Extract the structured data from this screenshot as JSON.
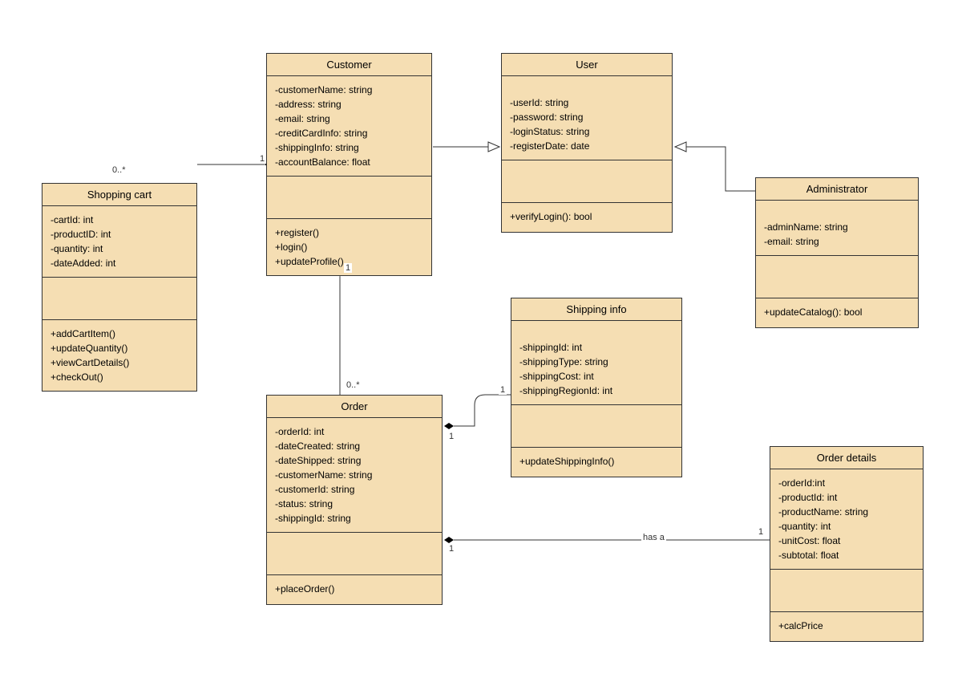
{
  "classes": {
    "shoppingCart": {
      "title": "Shopping cart",
      "attributes": [
        "-cartId: int",
        "-productID: int",
        "-quantity: int",
        "-dateAdded: int"
      ],
      "methods": [
        "+addCartItem()",
        "+updateQuantity()",
        "+viewCartDetails()",
        "+checkOut()"
      ]
    },
    "customer": {
      "title": "Customer",
      "attributes": [
        "-customerName: string",
        "-address: string",
        "-email: string",
        "-creditCardInfo: string",
        "-shippingInfo: string",
        "-accountBalance: float"
      ],
      "methods": [
        "+register()",
        "+login()",
        "+updateProfile()"
      ]
    },
    "user": {
      "title": "User",
      "attributes": [
        "-userId: string",
        "-password: string",
        "-loginStatus: string",
        "-registerDate: date"
      ],
      "methods": [
        "+verifyLogin(): bool"
      ]
    },
    "administrator": {
      "title": "Administrator",
      "attributes": [
        "-adminName: string",
        "-email: string"
      ],
      "methods": [
        "+updateCatalog(): bool"
      ]
    },
    "shippingInfo": {
      "title": "Shipping info",
      "attributes": [
        "-shippingId: int",
        "-shippingType: string",
        "-shippingCost: int",
        "-shippingRegionId: int"
      ],
      "methods": [
        "+updateShippingInfo()"
      ]
    },
    "order": {
      "title": "Order",
      "attributes": [
        "-orderId: int",
        "-dateCreated: string",
        "-dateShipped: string",
        "-customerName: string",
        "-customerId: string",
        "-status: string",
        "-shippingId: string"
      ],
      "methods": [
        "+placeOrder()"
      ]
    },
    "orderDetails": {
      "title": "Order details",
      "attributes": [
        "-orderId:int",
        "-productId: int",
        "-productName: string",
        "-quantity: int",
        "-unitCost: float",
        "-subtotal: float"
      ],
      "methods": [
        "+calcPrice"
      ]
    }
  },
  "labels": {
    "zeroStar1": "0..*",
    "zeroStar2": "0..*",
    "one1": "1",
    "one2": "1",
    "one3": "1",
    "one4": "1",
    "one5": "1",
    "one6": "1",
    "hasA": "has a"
  }
}
